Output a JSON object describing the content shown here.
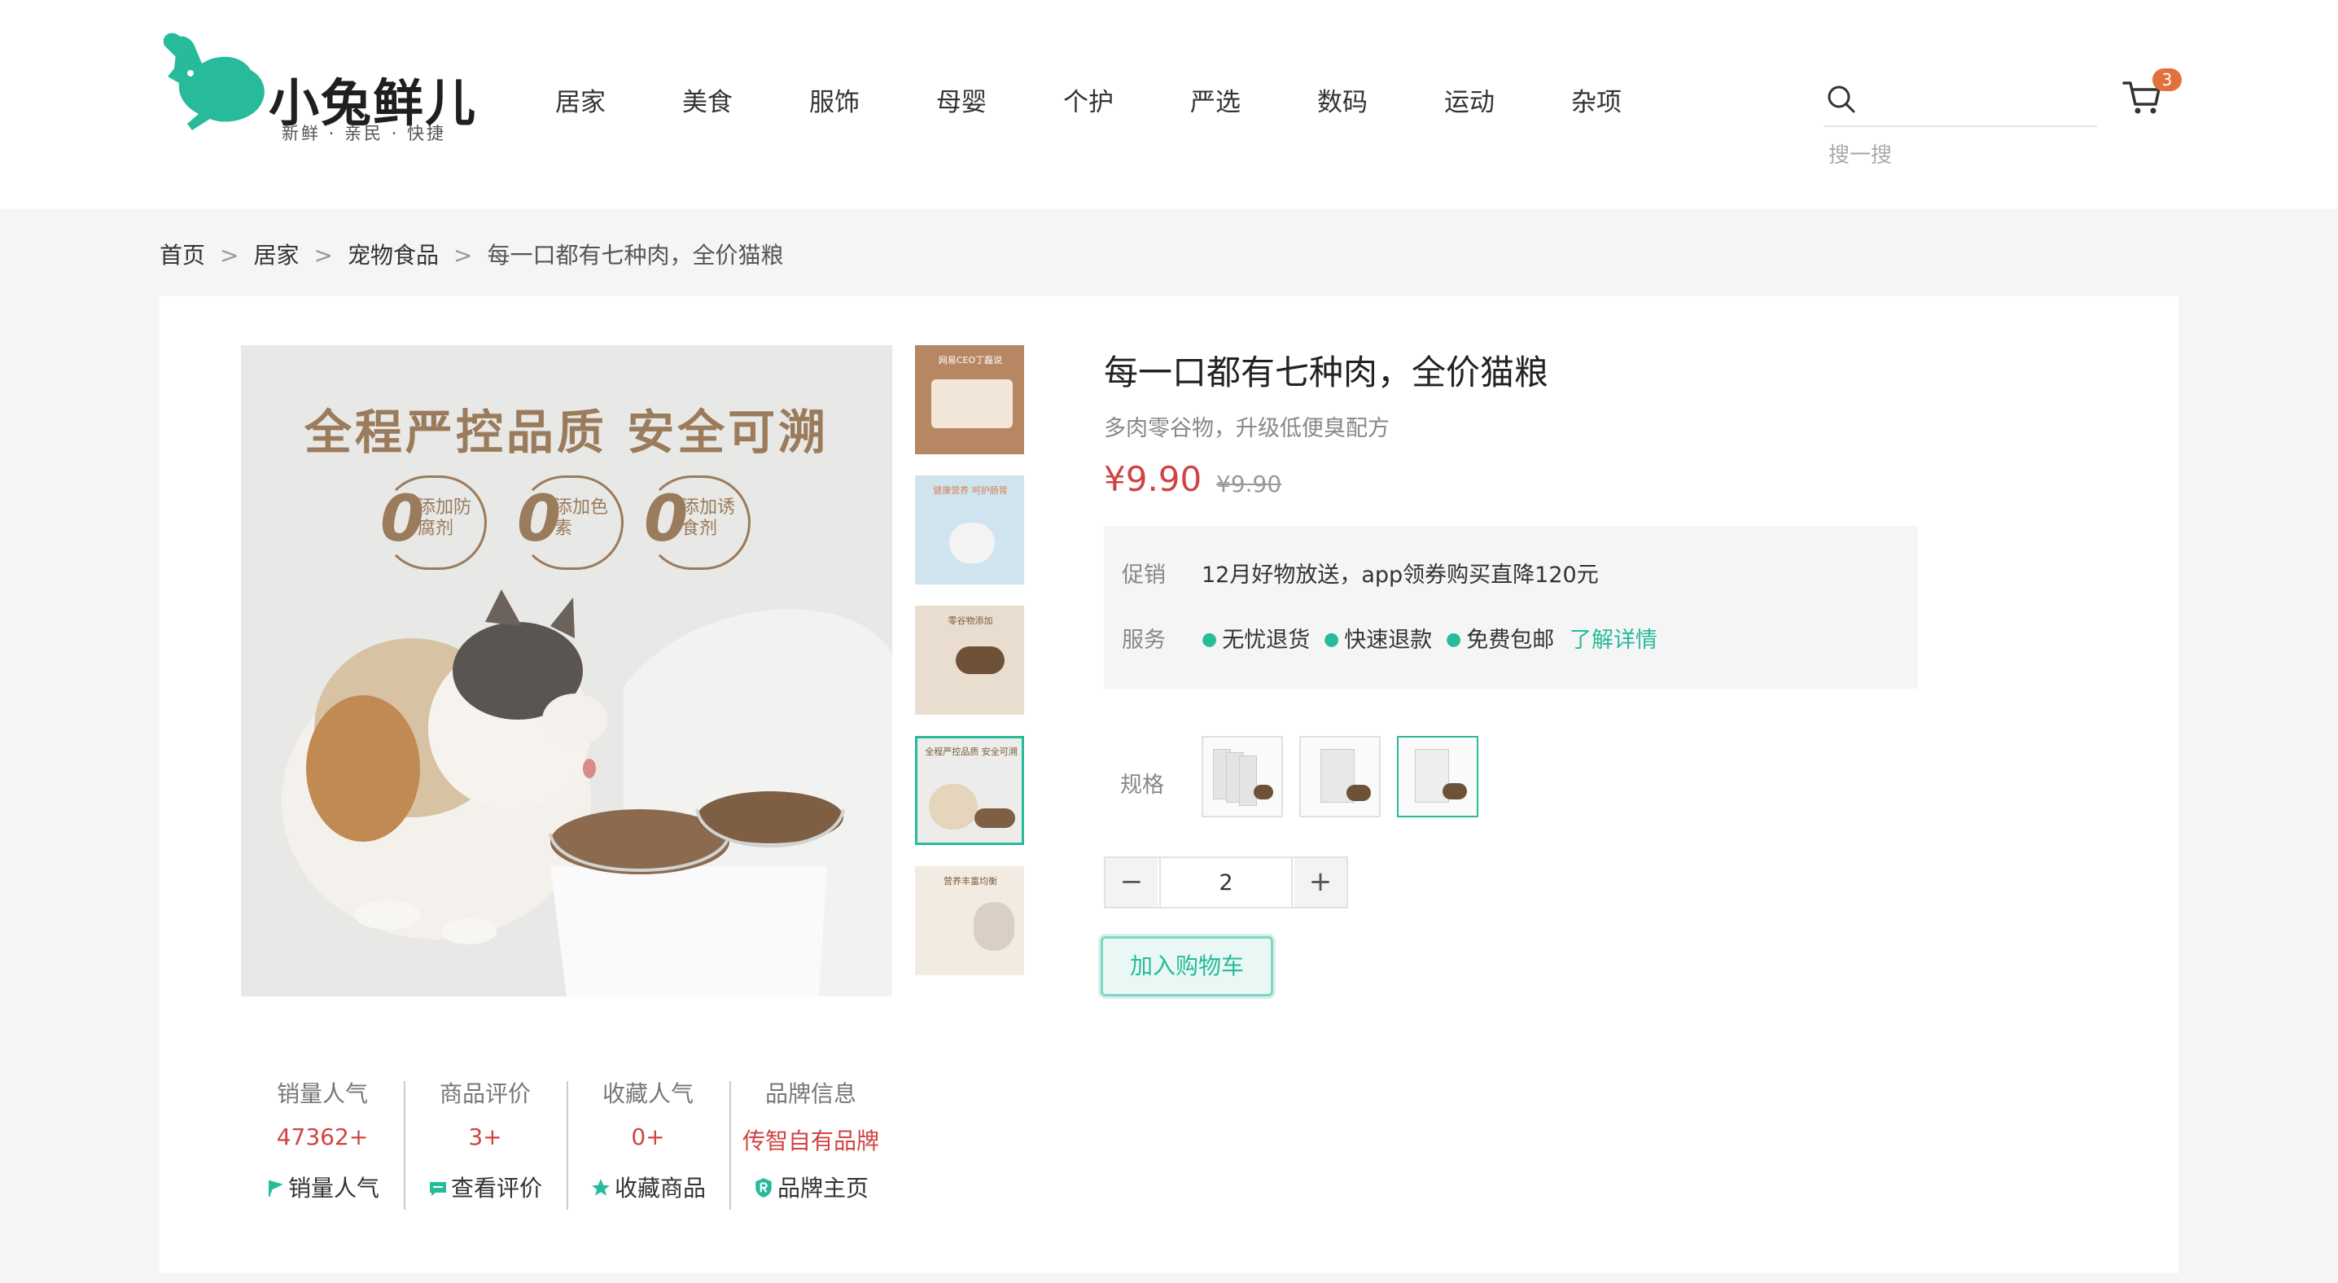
{
  "brand": {
    "name": "小兔鲜儿",
    "slogan": "新鲜 · 亲民 · 快捷"
  },
  "nav": [
    "居家",
    "美食",
    "服饰",
    "母婴",
    "个护",
    "严选",
    "数码",
    "运动",
    "杂项"
  ],
  "search": {
    "placeholder": "",
    "hint": "搜一搜"
  },
  "cart": {
    "count": "3"
  },
  "breadcrumb": {
    "items": [
      "首页",
      "居家",
      "宠物食品"
    ],
    "current": "每一口都有七种肉，全价猫粮",
    "separator": ">"
  },
  "gallery": {
    "main_title": "全程严控品质 安全可溯",
    "badges": [
      {
        "zero": "0",
        "text": "添加防腐剂"
      },
      {
        "zero": "0",
        "text": "添加色素"
      },
      {
        "zero": "0",
        "text": "添加诱食剂"
      }
    ],
    "thumb_captions": [
      "网易CEO丁磊说",
      "健康营养 呵护肠胃",
      "零谷物添加",
      "全程严控品质 安全可溯",
      "营养丰富均衡"
    ],
    "active_thumb": 3
  },
  "stats": [
    {
      "label": "销量人气",
      "value": "47362+",
      "link": "销量人气",
      "icon": "flag-icon"
    },
    {
      "label": "商品评价",
      "value": "3+",
      "link": "查看评价",
      "icon": "comment-icon"
    },
    {
      "label": "收藏人气",
      "value": "0+",
      "link": "收藏商品",
      "icon": "star-icon"
    },
    {
      "label": "品牌信息",
      "value": "传智自有品牌",
      "link": "品牌主页",
      "icon": "brand-icon"
    }
  ],
  "product": {
    "title": "每一口都有七种肉，全价猫粮",
    "desc": "多肉零谷物，升级低便臭配方",
    "price": "¥9.90",
    "old_price": "¥9.90"
  },
  "promo": {
    "label": "促销",
    "text": "12月好物放送，app领券购买直降120元",
    "service_label": "服务",
    "services": [
      "无忧退货",
      "快速退款",
      "免费包邮"
    ],
    "more": "了解详情"
  },
  "spec": {
    "label": "规格",
    "selected": 2
  },
  "quantity": {
    "value": "2",
    "minus": "−",
    "plus": "+"
  },
  "add_to_cart": "加入购物车",
  "colors": {
    "accent": "#27ba9b",
    "price": "#cf4444",
    "badge": "#e2703b"
  }
}
